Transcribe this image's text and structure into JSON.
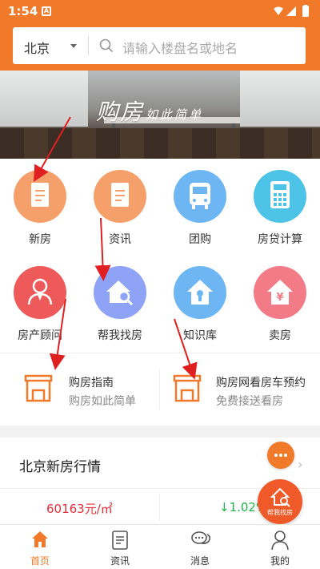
{
  "status_bar": {
    "time": "1:54",
    "notification_icon": "A"
  },
  "header": {
    "city": "北京",
    "search_placeholder": "请输入楼盘名或地名",
    "accent_color": "#f07a2a"
  },
  "banner": {
    "text_main": "购房",
    "text_small": "如此简单"
  },
  "grid": {
    "items": [
      {
        "label": "新房",
        "icon": "document-icon",
        "color": "#f5a06b"
      },
      {
        "label": "资讯",
        "icon": "news-icon",
        "color": "#f5a06b"
      },
      {
        "label": "团购",
        "icon": "bus-icon",
        "color": "#6eb6f3"
      },
      {
        "label": "房贷计算",
        "icon": "calculator-icon",
        "color": "#4ec3e8"
      },
      {
        "label": "房产顾问",
        "icon": "advisor-icon",
        "color": "#ee5a5a"
      },
      {
        "label": "帮我找房",
        "icon": "house-search-icon",
        "color": "#8ea3f6"
      },
      {
        "label": "知识库",
        "icon": "house-knowledge-icon",
        "color": "#6eb6f3"
      },
      {
        "label": "卖房",
        "icon": "house-yen-icon",
        "color": "#f27b87"
      }
    ]
  },
  "guides": [
    {
      "title": "购房指南",
      "subtitle": "购房如此简单"
    },
    {
      "title": "购房网看房车预约",
      "subtitle": "免费接送看房"
    }
  ],
  "market": {
    "title": "北京新房行情",
    "price": "60163元/㎡",
    "change": "↓1.02%",
    "price_color": "#e3303a",
    "change_color": "#22b24c"
  },
  "floating": {
    "helper_label": "帮我找房"
  },
  "bottom_nav": {
    "items": [
      {
        "label": "首页",
        "active": true
      },
      {
        "label": "资讯",
        "active": false
      },
      {
        "label": "消息",
        "active": false
      },
      {
        "label": "我的",
        "active": false
      }
    ]
  }
}
